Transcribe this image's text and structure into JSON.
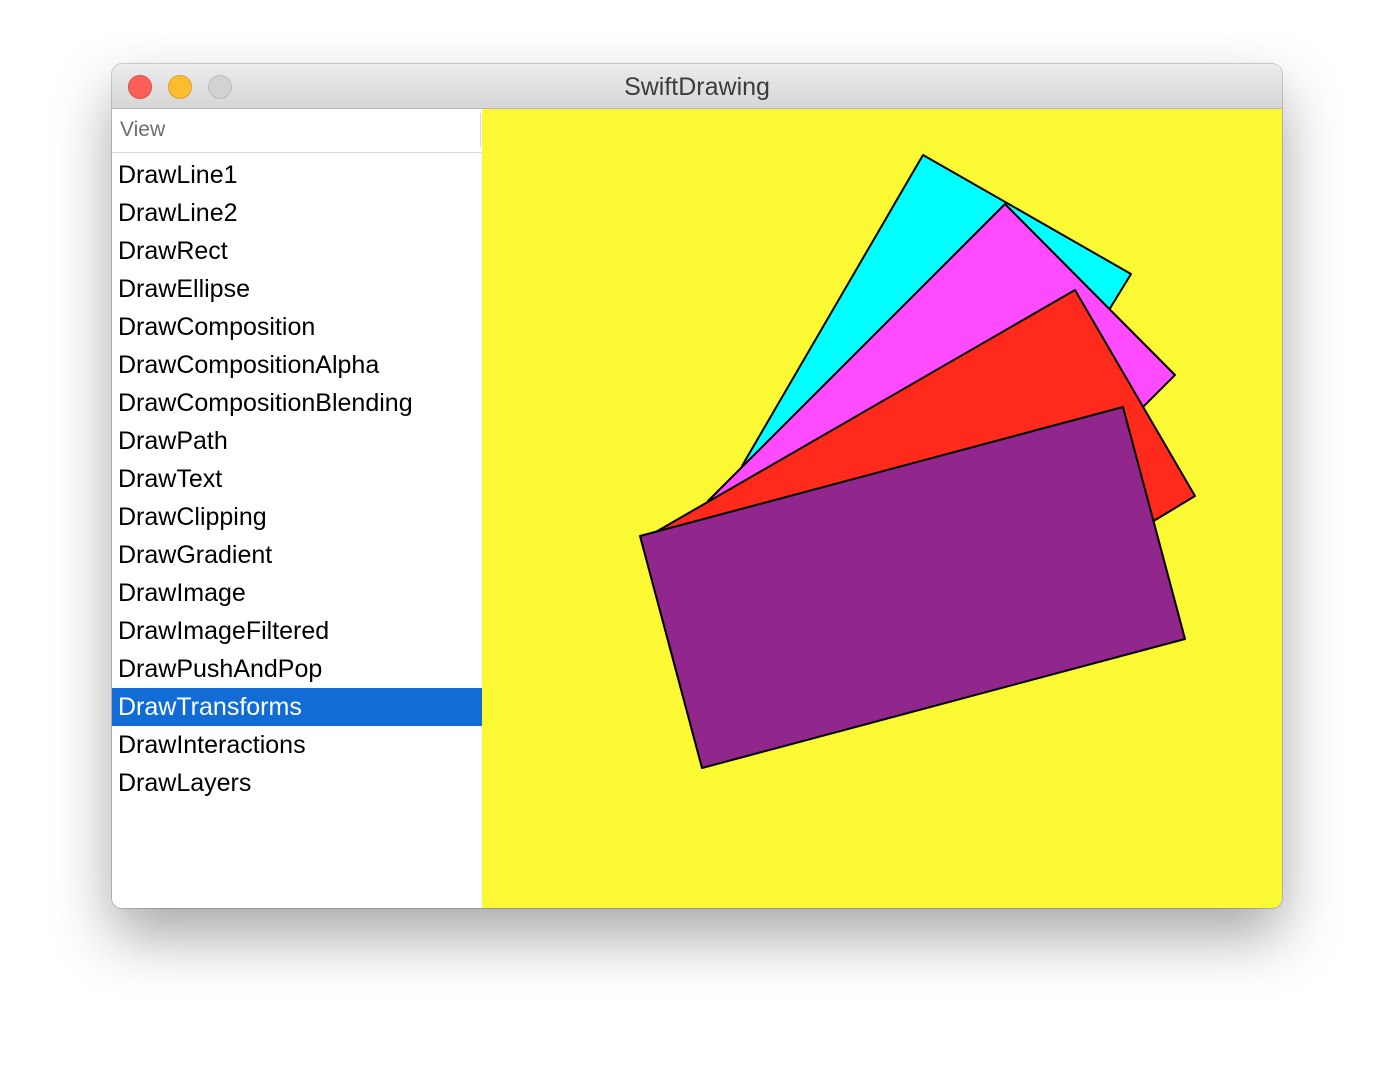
{
  "window": {
    "title": "SwiftDrawing"
  },
  "sidebar": {
    "header": "View",
    "items": [
      {
        "label": "DrawLine1",
        "selected": false
      },
      {
        "label": "DrawLine2",
        "selected": false
      },
      {
        "label": "DrawRect",
        "selected": false
      },
      {
        "label": "DrawEllipse",
        "selected": false
      },
      {
        "label": "DrawComposition",
        "selected": false
      },
      {
        "label": "DrawCompositionAlpha",
        "selected": false
      },
      {
        "label": "DrawCompositionBlending",
        "selected": false
      },
      {
        "label": "DrawPath",
        "selected": false
      },
      {
        "label": "DrawText",
        "selected": false
      },
      {
        "label": "DrawClipping",
        "selected": false
      },
      {
        "label": "DrawGradient",
        "selected": false
      },
      {
        "label": "DrawImage",
        "selected": false
      },
      {
        "label": "DrawImageFiltered",
        "selected": false
      },
      {
        "label": "DrawPushAndPop",
        "selected": false
      },
      {
        "label": "DrawTransforms",
        "selected": true
      },
      {
        "label": "DrawInteractions",
        "selected": false
      },
      {
        "label": "DrawLayers",
        "selected": false
      }
    ]
  },
  "canvas": {
    "background": "#fbf834",
    "rectangles": [
      {
        "fill": "#00ffff",
        "stroke": "#000000"
      },
      {
        "fill": "#ff4bff",
        "stroke": "#000000"
      },
      {
        "fill": "#ff2a1c",
        "stroke": "#000000"
      },
      {
        "fill": "#91278c",
        "stroke": "#000000"
      }
    ]
  }
}
